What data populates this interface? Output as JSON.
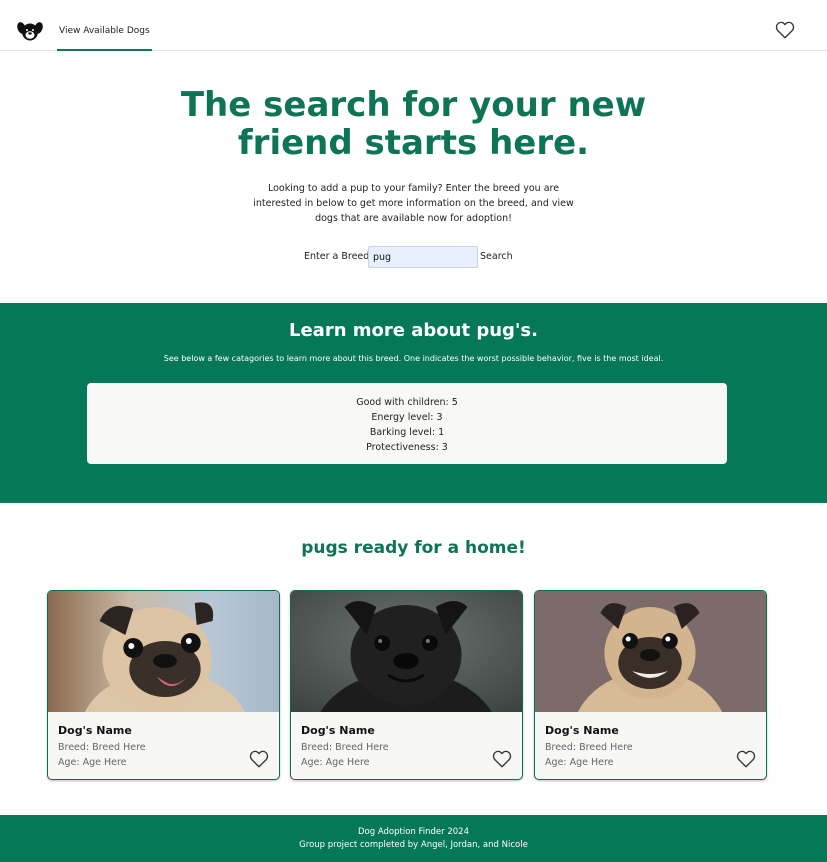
{
  "nav": {
    "logo_icon": "dog-face-icon",
    "link_label": "View Available Dogs",
    "favorites_icon": "heart-outline-icon"
  },
  "hero": {
    "title_line1": "The search for your new",
    "title_line2": "friend starts here.",
    "description": "Looking to add a pup to your family? Enter the breed you are interested in below to get more information on the breed, and view dogs that are available now for adoption!"
  },
  "search": {
    "label": "Enter a Breed:",
    "value": "pug",
    "button_label": "Search"
  },
  "learn": {
    "title": "Learn more about pug's.",
    "subtitle": "See below a few catagories to learn more about this breed. One indicates the worst possible behavior, five is the most ideal.",
    "traits": [
      "Good with children: 5",
      "Energy level: 3",
      "Barking level: 1",
      "Protectiveness: 3"
    ]
  },
  "ready": {
    "title": "pugs ready for a home!"
  },
  "cards": [
    {
      "name": "Dog's Name",
      "breed": "Breed: Breed Here",
      "age": "Age: Age Here",
      "photo_icon": "fawn-pug-photo",
      "fav_icon": "heart-outline-icon"
    },
    {
      "name": "Dog's Name",
      "breed": "Breed: Breed Here",
      "age": "Age: Age Here",
      "photo_icon": "black-pug-photo",
      "fav_icon": "heart-outline-icon"
    },
    {
      "name": "Dog's Name",
      "breed": "Breed: Breed Here",
      "age": "Age: Age Here",
      "photo_icon": "fawn-pug-photo",
      "fav_icon": "heart-outline-icon"
    }
  ],
  "footer": {
    "line1": "Dog Adoption Finder 2024",
    "line2": "Group project completed by Angel, Jordan, and Nicole"
  },
  "colors": {
    "brand_green": "#06785a",
    "title_green": "#0e7456",
    "input_bg": "#e8f0fe"
  }
}
